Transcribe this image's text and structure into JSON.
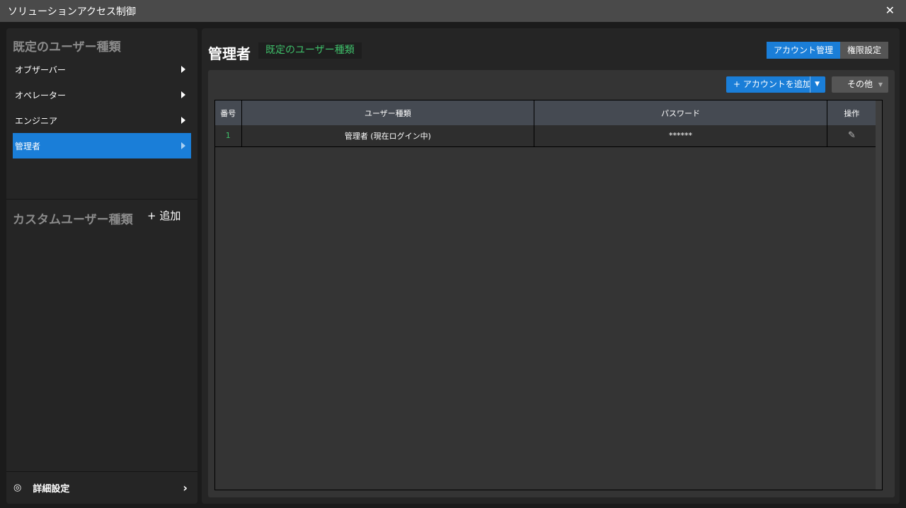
{
  "window": {
    "title": "ソリューションアクセス制御",
    "close": "✕"
  },
  "sidebar": {
    "preset_title": "既定のユーザー種類",
    "items": [
      {
        "label": "オブザーバー"
      },
      {
        "label": "オペレーター"
      },
      {
        "label": "エンジニア"
      },
      {
        "label": "管理者"
      }
    ],
    "custom_title": "カスタムユーザー種類",
    "add_label": "+ 追加",
    "advanced_label": "詳細設定"
  },
  "main": {
    "title": "管理者",
    "badge": "既定のユーザー種類",
    "tabs": [
      "アカウント管理",
      "権限設定"
    ],
    "add_account": "+ アカウントを追加",
    "other": "その他",
    "columns": [
      "番号",
      "ユーザー種類",
      "パスワード",
      "操作"
    ],
    "rows": [
      {
        "no": "1",
        "type": "管理者 (現在ログイン中)",
        "password": "******"
      }
    ]
  },
  "colors": {
    "accent": "#1a7ed8",
    "badge": "#3fbf6a"
  }
}
